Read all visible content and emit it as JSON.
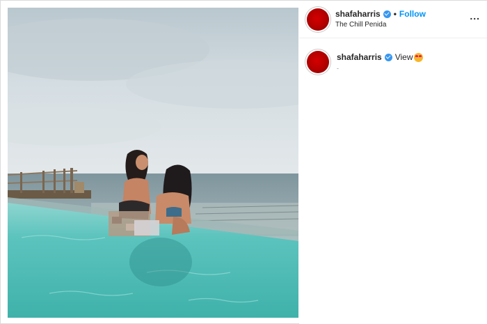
{
  "post": {
    "username": "shafaharris",
    "follow_label": "Follow",
    "separator": "•",
    "location": "The Chill Penida",
    "more_label": "...",
    "caption_user": "shafaharris",
    "caption_text": "View",
    "caption_meta": "-"
  },
  "colors": {
    "follow": "#0095f6",
    "verified": "#3897f0",
    "avatar": "#c40000",
    "pool": "#5fc6c0",
    "sky": "#c9d6dc",
    "sea": "#8fa7b0"
  },
  "icons": {
    "verified": "verified-badge-icon",
    "emoji": "heart-eyes-emoji-icon",
    "more": "more-options-icon"
  }
}
